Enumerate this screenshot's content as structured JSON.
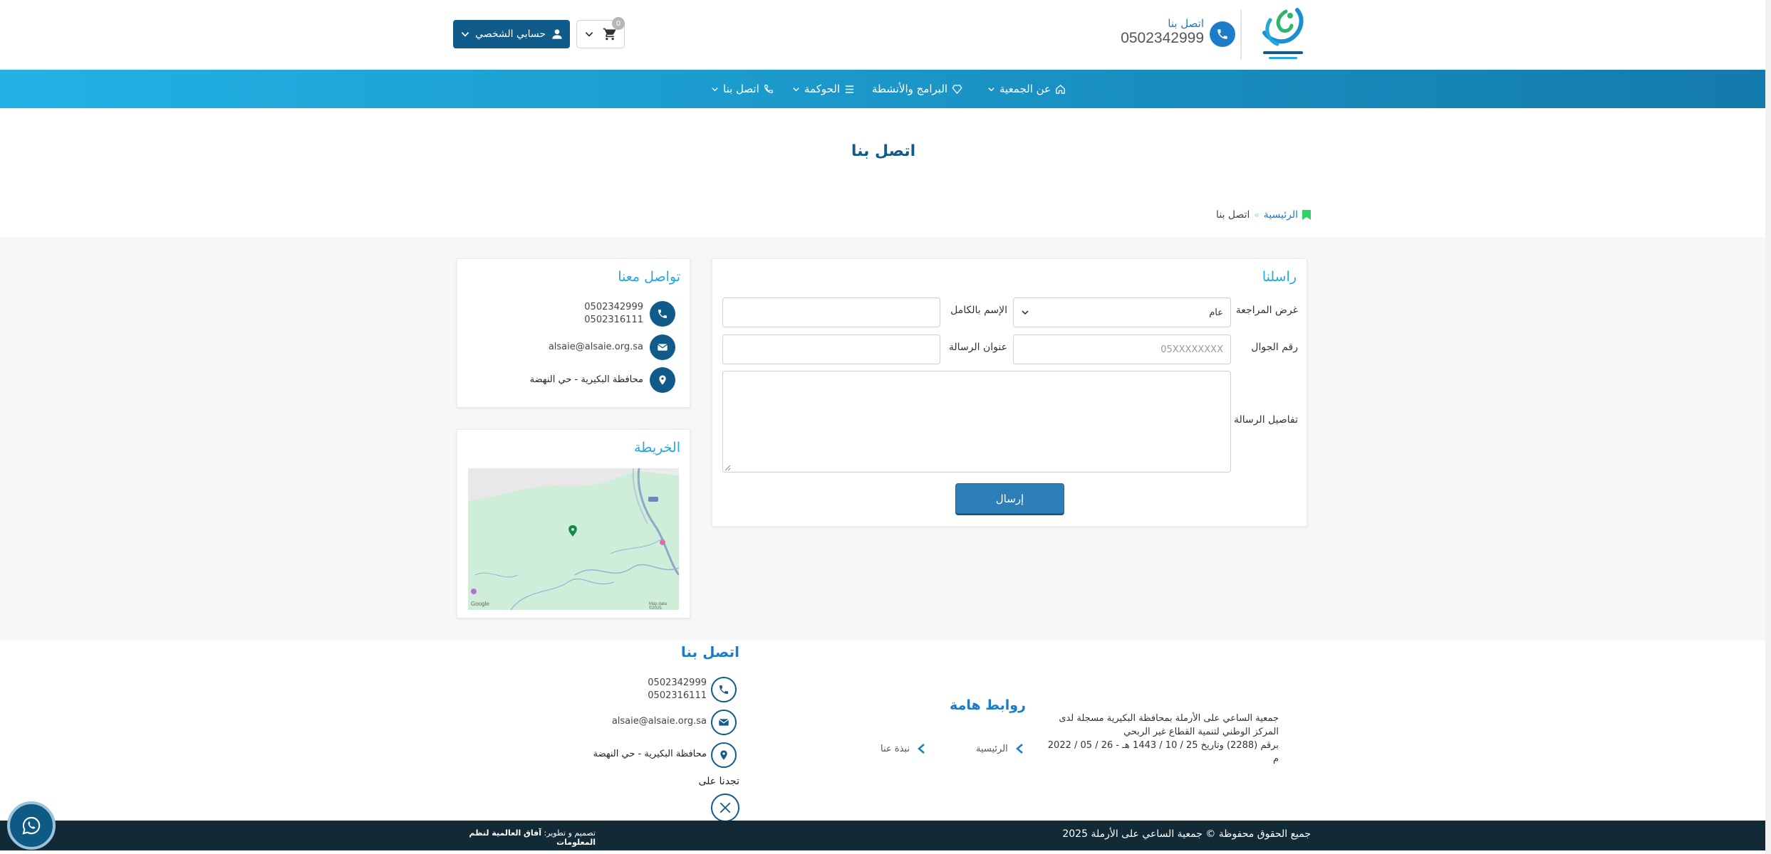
{
  "header": {
    "contact_label": "اتصل بنا",
    "phone": "0502342999",
    "cart_count": "0",
    "account_label": "حسابي الشخصي"
  },
  "nav": {
    "items": [
      {
        "label": "عن الجمعية",
        "icon": "home-icon"
      },
      {
        "label": "البرامج والأنشطة",
        "icon": "gem-icon"
      },
      {
        "label": "الحوكمة",
        "icon": "list-icon"
      },
      {
        "label": "اتصل بنا",
        "icon": "phone-icon"
      }
    ]
  },
  "page": {
    "title": "اتصل بنا",
    "breadcrumb": {
      "home": "الرئيسية",
      "sep": "»",
      "current": "اتصل بنا"
    }
  },
  "form": {
    "title": "راسلنا",
    "purpose_label": "غرض المراجعة",
    "purpose_value": "عام",
    "fullname_label": "الإسم بالكامل",
    "fullname_value": "",
    "mobile_label": "رقم الجوال",
    "mobile_placeholder": "05XXXXXXXX",
    "subject_label": "عنوان الرسالة",
    "subject_value": "",
    "details_label": "تفاصيل الرسالة",
    "details_value": "",
    "submit_label": "إرسال"
  },
  "contact": {
    "title": "تواصل معنا",
    "phone1": "0502342999",
    "phone2": "0502316111",
    "email": "alsaie@alsaie.org.sa",
    "address": "محافظة البكيرية - حي النهضة"
  },
  "map": {
    "title": "الخريطة",
    "google": "Google",
    "map_data": "Map data ©2025"
  },
  "footer": {
    "contact_title": "اتصل بنا",
    "phone1": "0502342999",
    "phone2": "0502316111",
    "email": "alsaie@alsaie.org.sa",
    "address": "محافظة البكيرية - حي النهضة",
    "find_us": "تجدنا على",
    "links_title": "روابط هامة",
    "links": [
      "الرئيسية",
      "نبذة عنا"
    ],
    "association_lines": [
      "جمعية الساعي على الأرملة بمحافظة البكيرية مسجلة لدى",
      "المركز الوطني لتنمية القطاع غير الربحي",
      "برقم (2288) وتاريخ 25 / 10 / 1443 هـ - 26 / 05 / 2022 م"
    ],
    "copyright": "جميع الحقوق محفوظة © جمعية الساعي على الأرملة 2025",
    "credit_prefix": "تصميم و تطوير:",
    "credit_company": "آفاق العالمية لنظم المعلومات"
  },
  "colors": {
    "primary": "#105b8a",
    "accent": "#22a9dc",
    "nav_gradient_start": "#22b2e5",
    "nav_gradient_end": "#137bab",
    "footer_bar": "#122a36",
    "breadcrumb_icon": "#2fd36a"
  }
}
